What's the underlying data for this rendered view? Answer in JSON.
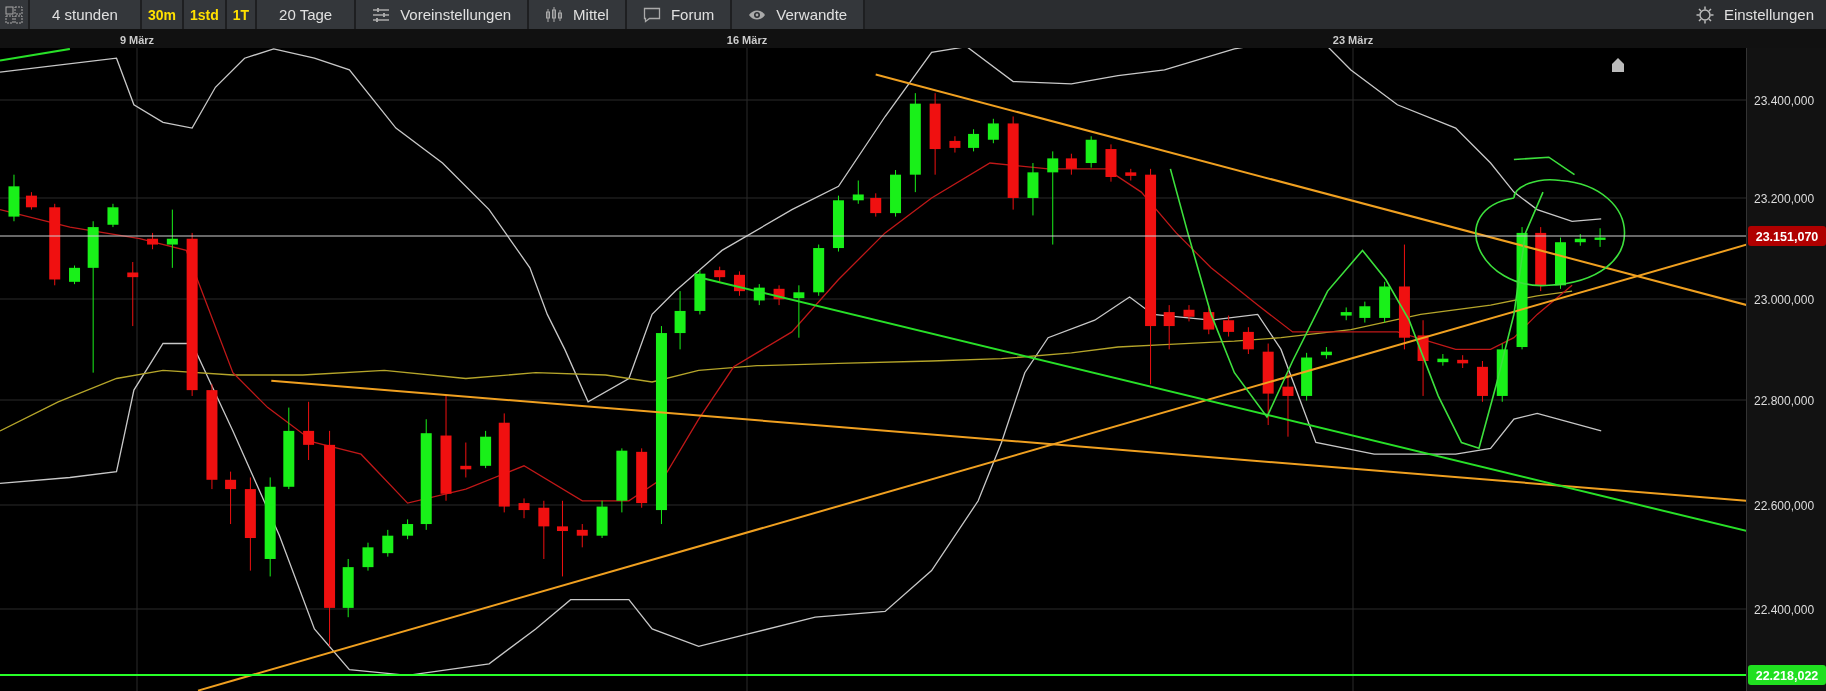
{
  "toolbar": {
    "items": [
      {
        "label": "4 stunden",
        "kind": "range"
      },
      {
        "label": "30m",
        "kind": "interval"
      },
      {
        "label": "1std",
        "kind": "interval"
      },
      {
        "label": "1T",
        "kind": "interval"
      },
      {
        "label": "20 Tage",
        "kind": "range"
      },
      {
        "label": "Voreinstellungen",
        "kind": "menu"
      },
      {
        "label": "Mittel",
        "kind": "menu"
      },
      {
        "label": "Forum",
        "kind": "menu"
      },
      {
        "label": "Verwandte",
        "kind": "menu"
      }
    ],
    "settings": {
      "label": "Einstellungen"
    }
  },
  "chart": {
    "date_labels": [
      "9 März",
      "16 März",
      "23 März"
    ],
    "price_labels": [
      "23.400,000",
      "23.200,000",
      "23.000,000",
      "22.800,000",
      "22.600,000",
      "22.400,000"
    ],
    "current_price": "23.151,070",
    "support_price": "22.218,022"
  }
}
